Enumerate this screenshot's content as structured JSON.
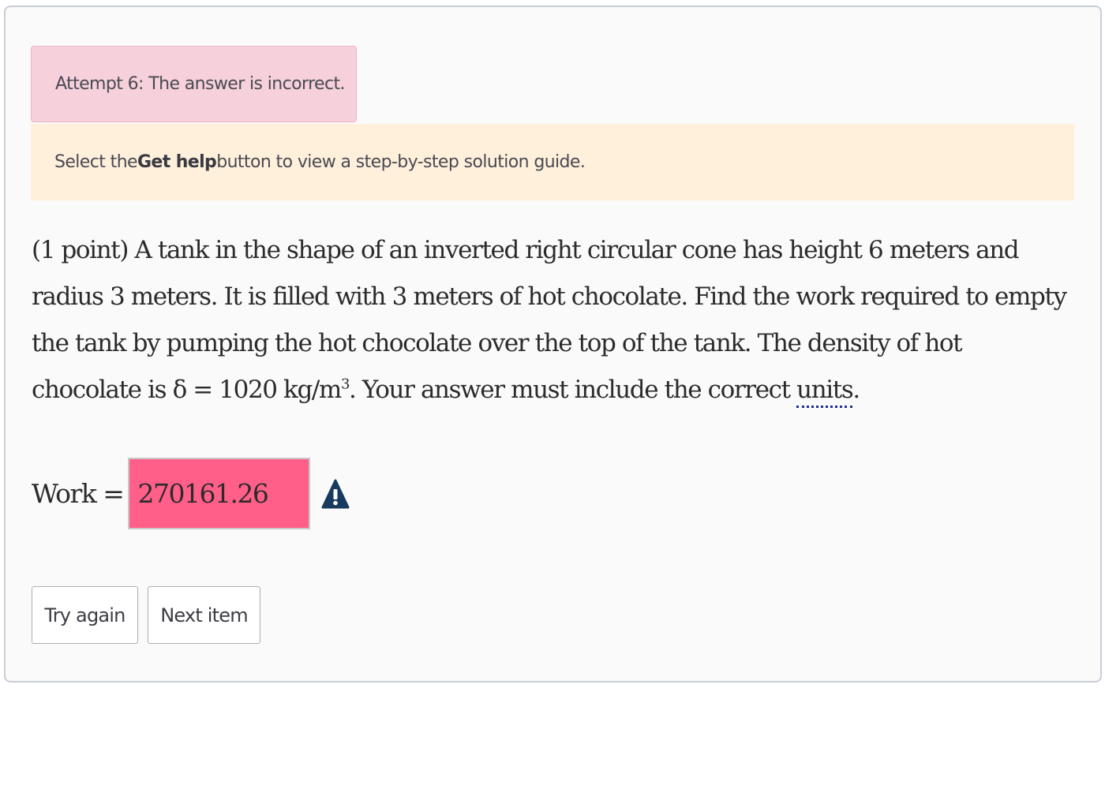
{
  "feedback": {
    "error_text": "Attempt 6: The answer is incorrect.",
    "info_prefix": "Select the ",
    "info_bold": "Get help",
    "info_suffix": " button to view a step-by-step solution guide."
  },
  "problem": {
    "points": "(1 point)",
    "text_1": " A tank in the shape of an inverted right circular cone has height 6 meters and radius 3 meters. It is filled with 3 meters of hot chocolate. Find the work required to empty the tank by pumping the hot chocolate over the top of the tank. The density of hot chocolate is ",
    "density_math": "δ = 1020 kg/m",
    "density_exp": "3",
    "text_2": ". Your answer must include the correct ",
    "units_link": "units",
    "text_end": "."
  },
  "answer": {
    "label": "Work =",
    "value": "270161.26",
    "status_icon": "warning-triangle-icon",
    "status_color": "#ff5f88"
  },
  "buttons": {
    "try_again": "Try again",
    "next_item": "Next item"
  }
}
